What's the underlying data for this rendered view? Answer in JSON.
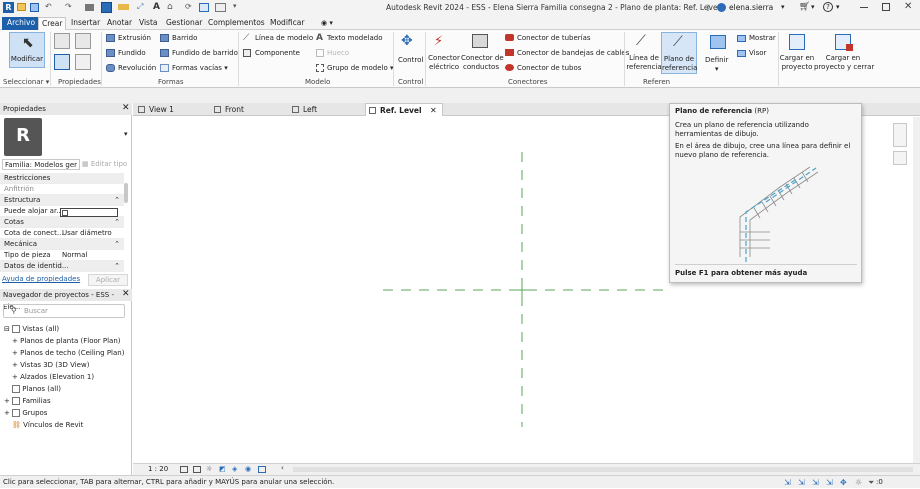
{
  "titlebar": {
    "app_title": "Autodesk Revit 2024 - ESS - Elena Sierra Familia consegna 2 - Plano de planta: Ref. Level",
    "user": "elena.sierra"
  },
  "ribbon_tabs": [
    "Archivo",
    "Crear",
    "Insertar",
    "Anotar",
    "Vista",
    "Gestionar",
    "Complementos",
    "Modificar"
  ],
  "ribbon": {
    "modificar": "Modificar",
    "seleccionar": "Seleccionar",
    "propiedades": "Propiedades",
    "extrusion": "Extrusión",
    "fundido": "Fundido",
    "revolucion": "Revolución",
    "barrido": "Barrido",
    "fundido_barrido": "Fundido de barrido",
    "formas_vacias": "Formas vacías",
    "formas_group": "Formas",
    "linea_modelo": "Línea de modelo",
    "componente": "Componente",
    "texto_modelado": "Texto modelado",
    "hueco": "Hueco",
    "grupo_modelo": "Grupo de modelo",
    "modelo_group": "Modelo",
    "control": "Control",
    "control_group": "Control",
    "conector_electrico": [
      "Conector",
      "eléctrico"
    ],
    "conector_conductos": [
      "Conector de",
      "conductos"
    ],
    "conector_tuberias": "Conector de tuberías",
    "conector_bandejas": "Conector de bandejas de cables",
    "conector_tubos": "Conector de tubos",
    "conectores_group": "Conectores",
    "linea_referencia": [
      "Línea de",
      "referencia"
    ],
    "plano_referencia": [
      "Plano de",
      "referencia"
    ],
    "referencia_group": "Referen",
    "definir": "Definir",
    "mostrar": "Mostrar",
    "visor": "Visor",
    "cargar_proyecto": [
      "Cargar en",
      "proyecto"
    ],
    "cargar_cerrar": [
      "Cargar en",
      "proyecto y cerrar"
    ]
  },
  "properties": {
    "header": "Propiedades",
    "type_selector": "Familia: Modelos ger",
    "edit_type": "Editar tipo",
    "rows": [
      {
        "label": "Restricciones",
        "value": "",
        "category": true
      },
      {
        "label": "Anfitrión",
        "value": "",
        "category": false
      },
      {
        "label": "Estructura",
        "value": "",
        "category": true
      },
      {
        "label": "Puede alojar ar...",
        "value": "",
        "category": false
      },
      {
        "label": "Cotas",
        "value": "",
        "category": true
      },
      {
        "label": "Cota de conect...",
        "value": "Usar diámetro",
        "category": false
      },
      {
        "label": "Mecánica",
        "value": "",
        "category": true
      },
      {
        "label": "Tipo de pieza",
        "value": "Normal",
        "category": false
      },
      {
        "label": "Datos de identid...",
        "value": "",
        "category": true
      }
    ],
    "help_link": "Ayuda de propiedades",
    "apply": "Aplicar"
  },
  "project_browser": {
    "header": "Navegador de proyectos - ESS - Ele...",
    "search_placeholder": "Buscar",
    "items": [
      {
        "text": "Vistas (all)",
        "level": 0
      },
      {
        "text": "Planos de planta (Floor Plan)",
        "level": 1
      },
      {
        "text": "Planos de techo (Ceiling Plan)",
        "level": 1
      },
      {
        "text": "Vistas 3D (3D View)",
        "level": 1
      },
      {
        "text": "Alzados (Elevation 1)",
        "level": 1
      },
      {
        "text": "Planos (all)",
        "level": 0
      },
      {
        "text": "Familias",
        "level": 0
      },
      {
        "text": "Grupos",
        "level": 0
      },
      {
        "text": "Vínculos de Revit",
        "level": 0
      }
    ]
  },
  "view_tabs": [
    "View 1",
    "Front",
    "Left",
    "Ref. Level"
  ],
  "tooltip": {
    "title": "Plano de referencia",
    "shortcut": "(RP)",
    "description": "Crea un plano de referencia utilizando herramientas de dibujo.",
    "instruction": "En el área de dibujo, cree una línea para definir el nuevo plano de referencia.",
    "help": "Pulse F1 para obtener más ayuda"
  },
  "view_controls": {
    "scale": "1 : 20"
  },
  "status_text": "Clic para seleccionar, TAB para alternar, CTRL para añadir y MAYÚS para anular una selección.",
  "status_right": ":0",
  "colors": {
    "accent": "#2b6cb8",
    "file_tab": "#1d5fa8",
    "ref_plane": "#5aa75a"
  }
}
